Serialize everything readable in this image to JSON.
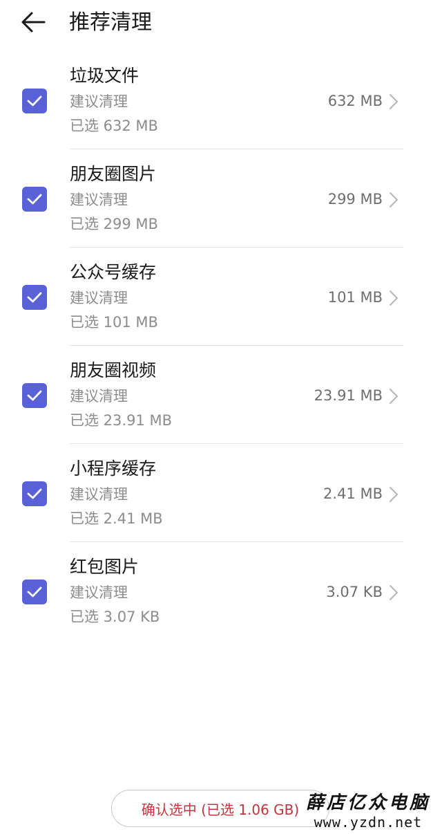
{
  "header": {
    "title": "推荐清理",
    "back_icon": "arrow-left-icon"
  },
  "items": [
    {
      "name": "垃圾文件",
      "hint": "建议清理",
      "selected": "已选 632 MB",
      "size": "632 MB",
      "checked": true
    },
    {
      "name": "朋友圈图片",
      "hint": "建议清理",
      "selected": "已选 299 MB",
      "size": "299 MB",
      "checked": true
    },
    {
      "name": "公众号缓存",
      "hint": "建议清理",
      "selected": "已选 101 MB",
      "size": "101 MB",
      "checked": true
    },
    {
      "name": "朋友圈视频",
      "hint": "建议清理",
      "selected": "已选 23.91 MB",
      "size": "23.91 MB",
      "checked": true
    },
    {
      "name": "小程序缓存",
      "hint": "建议清理",
      "selected": "已选 2.41 MB",
      "size": "2.41 MB",
      "checked": true
    },
    {
      "name": "红包图片",
      "hint": "建议清理",
      "selected": "已选 3.07 KB",
      "size": "3.07 KB",
      "checked": true
    }
  ],
  "footer": {
    "confirm_label": "确认选中 (已选 1.06 GB)"
  },
  "watermark": {
    "cn": "薛店亿众电脑",
    "url": "www.yzdn.net"
  },
  "colors": {
    "accent": "#5961d6",
    "confirm_text": "#c0353d"
  }
}
